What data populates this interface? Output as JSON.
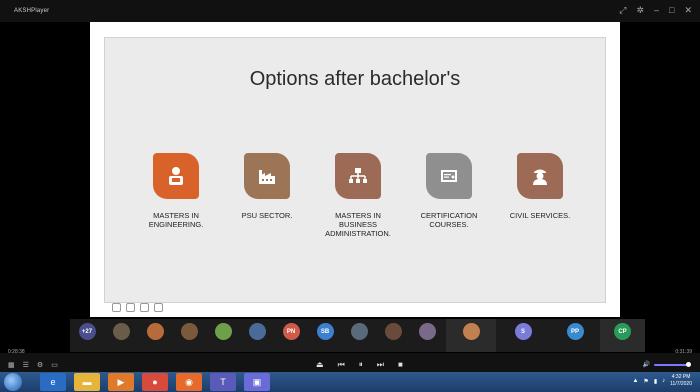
{
  "window": {
    "app_name": "AKSHPlayer",
    "title": "",
    "controls": [
      "minimize",
      "maximize",
      "close"
    ]
  },
  "slide": {
    "title": "Options after bachelor's",
    "options": [
      {
        "label": "MASTERS IN ENGINEERING.",
        "color": "#d9622b",
        "icon": "engineer-icon"
      },
      {
        "label": "PSU SECTOR.",
        "color": "#9c7456",
        "icon": "factory-icon"
      },
      {
        "label": "MASTERS IN BUSINESS ADMINISTRATION.",
        "color": "#9c6a55",
        "icon": "org-chart-icon"
      },
      {
        "label": "CERTIFICATION COURSES.",
        "color": "#8f8f8f",
        "icon": "certificate-icon"
      },
      {
        "label": "CIVIL SERVICES.",
        "color": "#9c6a55",
        "icon": "officer-icon"
      }
    ]
  },
  "participants": {
    "more_count": "+27",
    "people": [
      {
        "initials": "",
        "name": "",
        "color": "#6b5c4a"
      },
      {
        "initials": "",
        "name": "",
        "color": "#b96a3a"
      },
      {
        "initials": "",
        "name": "",
        "color": "#7a5a3a"
      },
      {
        "initials": "",
        "name": "",
        "color": "#6ea04a"
      },
      {
        "initials": "",
        "name": "",
        "color": "#4a6a9a"
      },
      {
        "initials": "PN",
        "name": "",
        "color": "#d05a4a"
      },
      {
        "initials": "SB",
        "name": "",
        "color": "#3d7fd0"
      },
      {
        "initials": "",
        "name": "",
        "color": "#5a6a7a"
      },
      {
        "initials": "",
        "name": "",
        "color": "#6a4a3a"
      },
      {
        "initials": "",
        "name": "",
        "color": "#7a6a8a"
      },
      {
        "initials": "",
        "name": "",
        "color": "#c08050"
      },
      {
        "initials": "S",
        "name": "",
        "color": "#7b7bd8"
      },
      {
        "initials": "PP",
        "name": "",
        "color": "#3a8ad0"
      },
      {
        "initials": "CP",
        "name": "",
        "color": "#2a9a5a"
      }
    ]
  },
  "player": {
    "time_elapsed": "0:28:38",
    "time_total": "0:31:39"
  },
  "taskbar": {
    "time": "4:32 PM",
    "date": "11/7/2020"
  },
  "colors": {
    "accent_orange": "#d9622b",
    "taskbar_blue": "#2e5a8e",
    "volume": "#7a7aff"
  }
}
